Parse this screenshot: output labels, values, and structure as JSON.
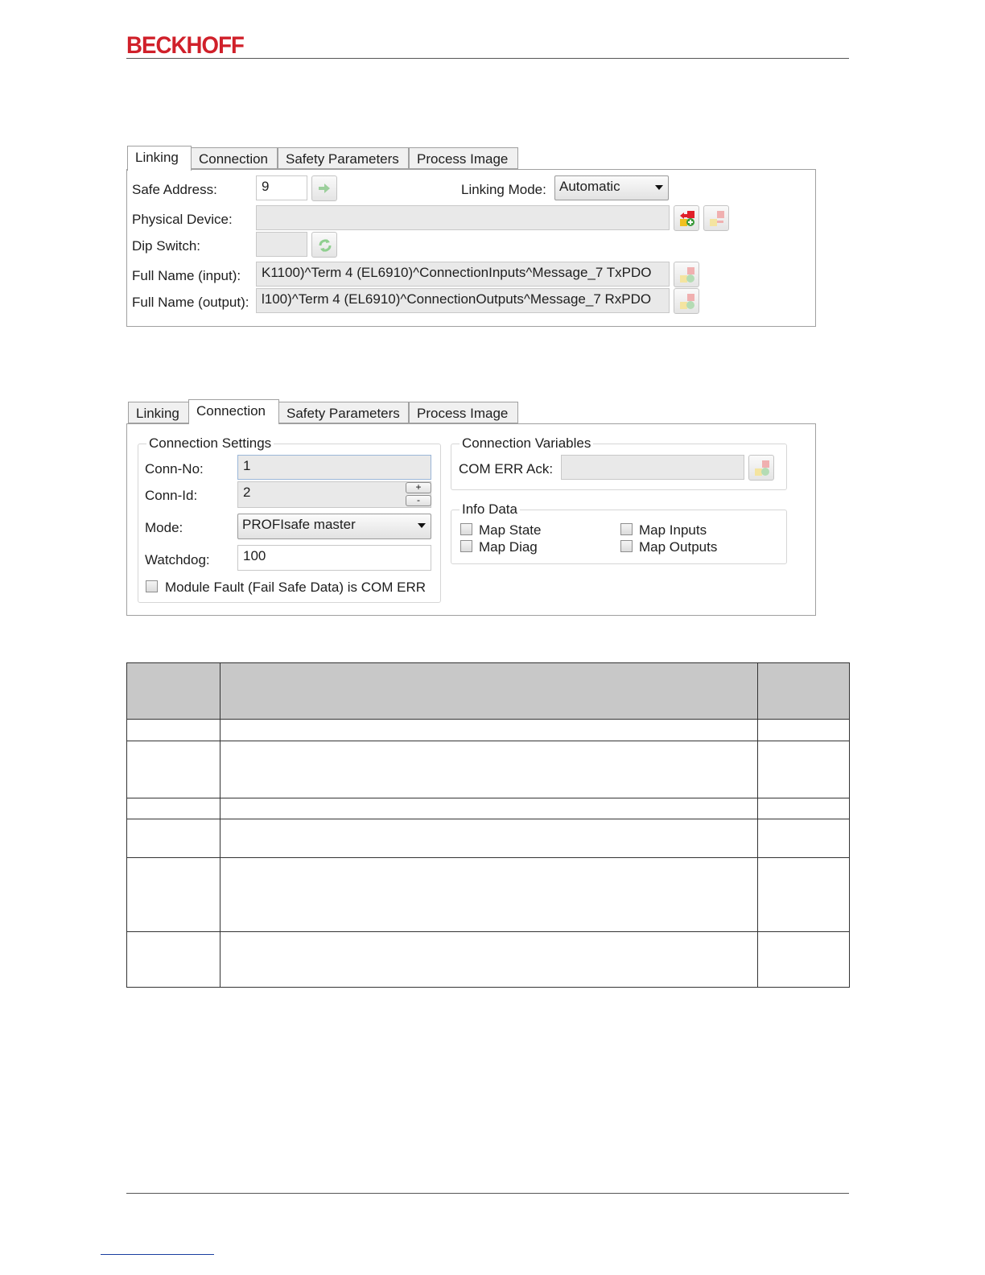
{
  "header": {
    "logo": "BECKHOFF"
  },
  "dialog1": {
    "tabs": [
      "Linking",
      "Connection",
      "Safety Parameters",
      "Process Image"
    ],
    "active_tab": "Linking",
    "safe_address": {
      "label": "Safe Address:",
      "value": "9"
    },
    "linking_mode": {
      "label": "Linking Mode:",
      "value": "Automatic"
    },
    "physical_device": {
      "label": "Physical Device:",
      "value": ""
    },
    "dip_switch": {
      "label": "Dip Switch:",
      "value": ""
    },
    "full_name_input": {
      "label": "Full Name (input):",
      "value": "K1100)^Term 4 (EL6910)^ConnectionInputs^Message_7 TxPDO"
    },
    "full_name_output": {
      "label": "Full Name (output):",
      "value": "l100)^Term 4 (EL6910)^ConnectionOutputs^Message_7 RxPDO"
    }
  },
  "dialog2": {
    "tabs": [
      "Linking",
      "Connection",
      "Safety Parameters",
      "Process Image"
    ],
    "active_tab": "Connection",
    "connection_settings": {
      "title": "Connection Settings",
      "conn_no": {
        "label": "Conn-No:",
        "value": "1"
      },
      "conn_id": {
        "label": "Conn-Id:",
        "value": "2",
        "plus": "+",
        "minus": "-"
      },
      "mode": {
        "label": "Mode:",
        "value": "PROFIsafe master"
      },
      "watchdog": {
        "label": "Watchdog:",
        "value": "100"
      },
      "module_fault": {
        "label": "Module Fault (Fail Safe Data) is COM ERR",
        "checked": false
      }
    },
    "connection_variables": {
      "title": "Connection Variables",
      "com_err_ack": {
        "label": "COM ERR Ack:",
        "value": ""
      }
    },
    "info_data": {
      "title": "Info Data",
      "map_state": "Map State",
      "map_diag": "Map Diag",
      "map_inputs": "Map Inputs",
      "map_outputs": "Map Outputs"
    }
  },
  "table": {
    "rows": 6,
    "columns": 3
  },
  "colors": {
    "logo_red": "#d0202a",
    "header_gray": "#c8c8c8",
    "tab_bg": "#f0f0f0"
  }
}
